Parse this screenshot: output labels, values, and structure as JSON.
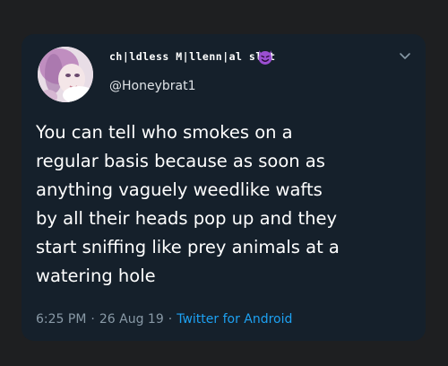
{
  "tweet": {
    "display_name": "ch|ldless M|llenn|al slut",
    "handle": "@Honeybrat1",
    "text": "You can tell who smokes on a\nregular basis because as soon as\nanything vaguely weedlike wafts\nby all their heads pop up and they\nstart sniffing like prey animals at a\nwatering hole",
    "time": "6:25 PM",
    "date": "26 Aug 19",
    "separator": "·",
    "source": "Twitter for Android"
  },
  "icons": {
    "name_emoji": "smiling-devil-icon",
    "menu": "chevron-down-icon"
  },
  "colors": {
    "background": "#1e1f21",
    "card": "#15202b",
    "text": "#ffffff",
    "meta": "#8899a6",
    "link": "#1da1f2",
    "emoji": "#9a4fd1"
  }
}
